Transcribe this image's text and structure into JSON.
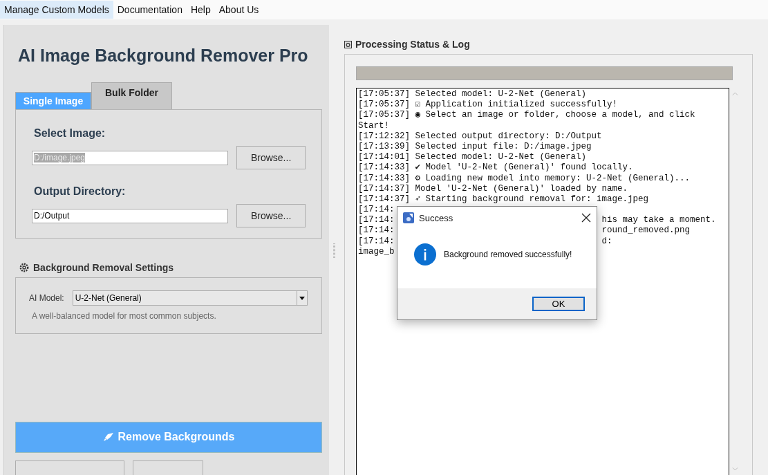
{
  "menu": [
    {
      "label": "Manage Custom Models",
      "selected": true
    },
    {
      "label": "Documentation",
      "selected": false
    },
    {
      "label": "Help",
      "selected": false
    },
    {
      "label": "About Us",
      "selected": false
    }
  ],
  "title": "AI Image Background Remover Pro",
  "tabs": [
    {
      "label": "Single Image",
      "selected": true
    },
    {
      "label": "Bulk Folder",
      "selected": false
    }
  ],
  "single_image": {
    "input_label": "Select Image:",
    "input_field": {
      "value": "D:/image.jpeg",
      "text_selected": true
    },
    "input_button": "Browse...",
    "output_label": "Output Directory:",
    "output_field": {
      "value": "D:/Output",
      "text_selected": false
    },
    "output_button": "Browse..."
  },
  "settings": {
    "title": "Background Removal Settings",
    "model_label": "AI Model:",
    "model": "U-2-Net (General)",
    "description": "A well-balanced model for most common subjects."
  },
  "remove_button": {
    "label": "Remove Backgrounds"
  },
  "log_panel": {
    "title": "Processing Status & Log",
    "progress": {
      "level": 0
    },
    "rows": [
      {
        "left": "[17:05:37] Selected model: U-2-Net (General)"
      },
      {
        "left": "[17:05:37] ☑ Application initialized successfully!"
      },
      {
        "left": "[17:05:37] ◉ Select an image or folder, choose a model, and click"
      },
      {
        "left": "Start!"
      },
      {
        "left": "[17:12:32] Selected output directory: D:/Output"
      },
      {
        "left": "[17:13:39] Selected input file: D:/image.jpeg"
      },
      {
        "left": "[17:14:01] Selected model: U-2-Net (General)"
      },
      {
        "left": "[17:14:33] ✔ Model 'U-2-Net (General)' found locally."
      },
      {
        "left": "[17:14:33] ⚙ Loading new model into memory: U-2-Net (General)..."
      },
      {
        "left": "[17:14:37] Model 'U-2-Net (General)' loaded by name."
      },
      {
        "left": "[17:14:37] ➶ Starting background removal for: image.jpeg"
      },
      {
        "left": "[17:14:"
      },
      {
        "left": "[17:14:",
        "right": "his may take a moment."
      },
      {
        "left": "[17:14:",
        "right": "round_removed.png"
      },
      {
        "left": "[17:14:",
        "right": "d:"
      },
      {
        "left": "image_b"
      }
    ]
  },
  "dialog": {
    "title": "Success",
    "message": "Background removed successfully!",
    "button": "OK"
  }
}
